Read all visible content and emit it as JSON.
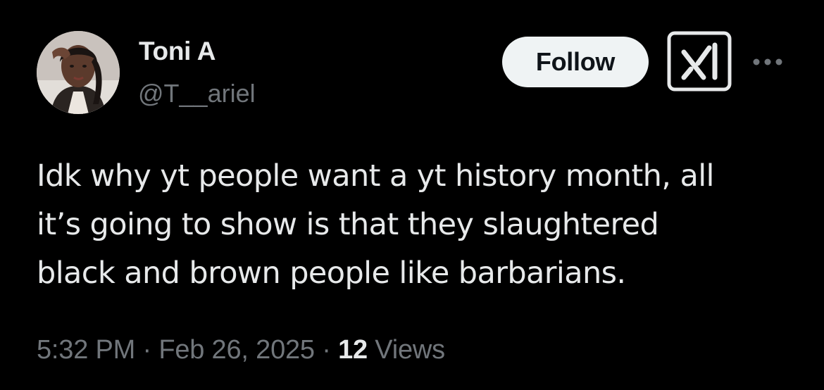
{
  "author": {
    "display_name": "Toni A",
    "handle": "@T__ariel"
  },
  "actions": {
    "follow_label": "Follow",
    "grok_icon": "grok-icon",
    "more_icon": "more-options-icon"
  },
  "tweet": {
    "lines": [
      "Idk why yt people want a yt history month, all",
      "it’s going to show is that they slaughtered",
      "black and brown people like barbarians."
    ]
  },
  "meta": {
    "time": "5:32 PM",
    "separator": "·",
    "date": "Feb 26, 2025",
    "views_count": "12",
    "views_label": "Views"
  },
  "colors": {
    "background": "#000000",
    "primary_text": "#e7e9ea",
    "secondary_text": "#71767b",
    "follow_button_bg": "#eff3f4"
  }
}
